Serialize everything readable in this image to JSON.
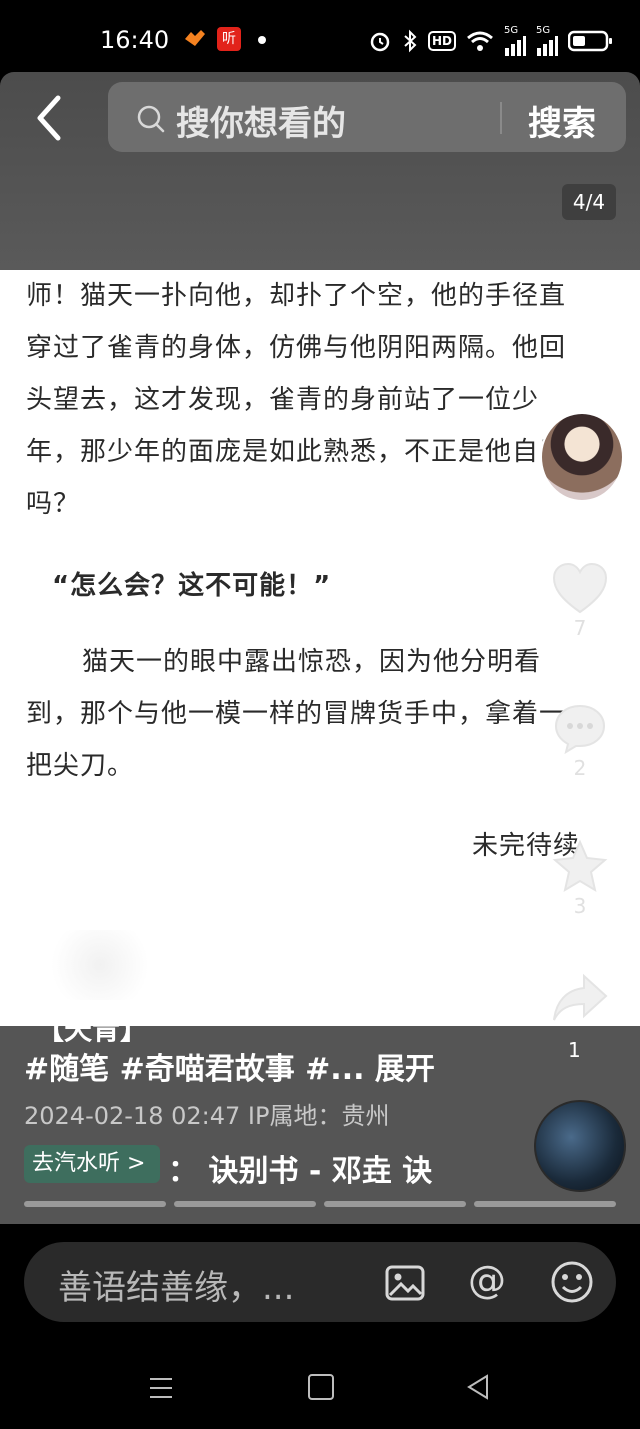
{
  "status_bar": {
    "time": "16:40",
    "app_badge": "听",
    "hd_label": "HD",
    "net1": "5G",
    "net2": "5G"
  },
  "search": {
    "placeholder": "搜你想看的",
    "button_label": "搜索"
  },
  "page_counter": "4/4",
  "article": {
    "paragraph_1": "师！猫天一扑向他，却扑了个空，他的手径直穿过了雀青的身体，仿佛与他阴阳两隔。他回头望去，这才发现，雀青的身前站了一位少年，那少年的面庞是如此熟悉，不正是他自己吗？",
    "paragraph_2": "“怎么会？这不可能！”",
    "paragraph_3": "猫天一的眼中露出惊恐，因为他分明看到，那个与他一模一样的冒牌货手中，拿着一把尖刀。",
    "paragraph_4": "未完待续"
  },
  "actions": {
    "like_count": "7",
    "comment_count": "2",
    "favorite_count": "3",
    "share_count": "1"
  },
  "post": {
    "title_fragment": "【天青】",
    "tags": "#随笔 #奇喵君故事 #... 展开",
    "meta": "2024-02-18 02:47  IP属地：贵州",
    "listen_chip": "去汽水听 >",
    "music": "：  诀别书 - 邓垚   诀"
  },
  "comment_bar": {
    "placeholder": "善语结善缘，..."
  },
  "colors": {
    "top_band": "#555555",
    "listen_chip": "#3e6e5e",
    "reader_bg": "#ffffff"
  }
}
